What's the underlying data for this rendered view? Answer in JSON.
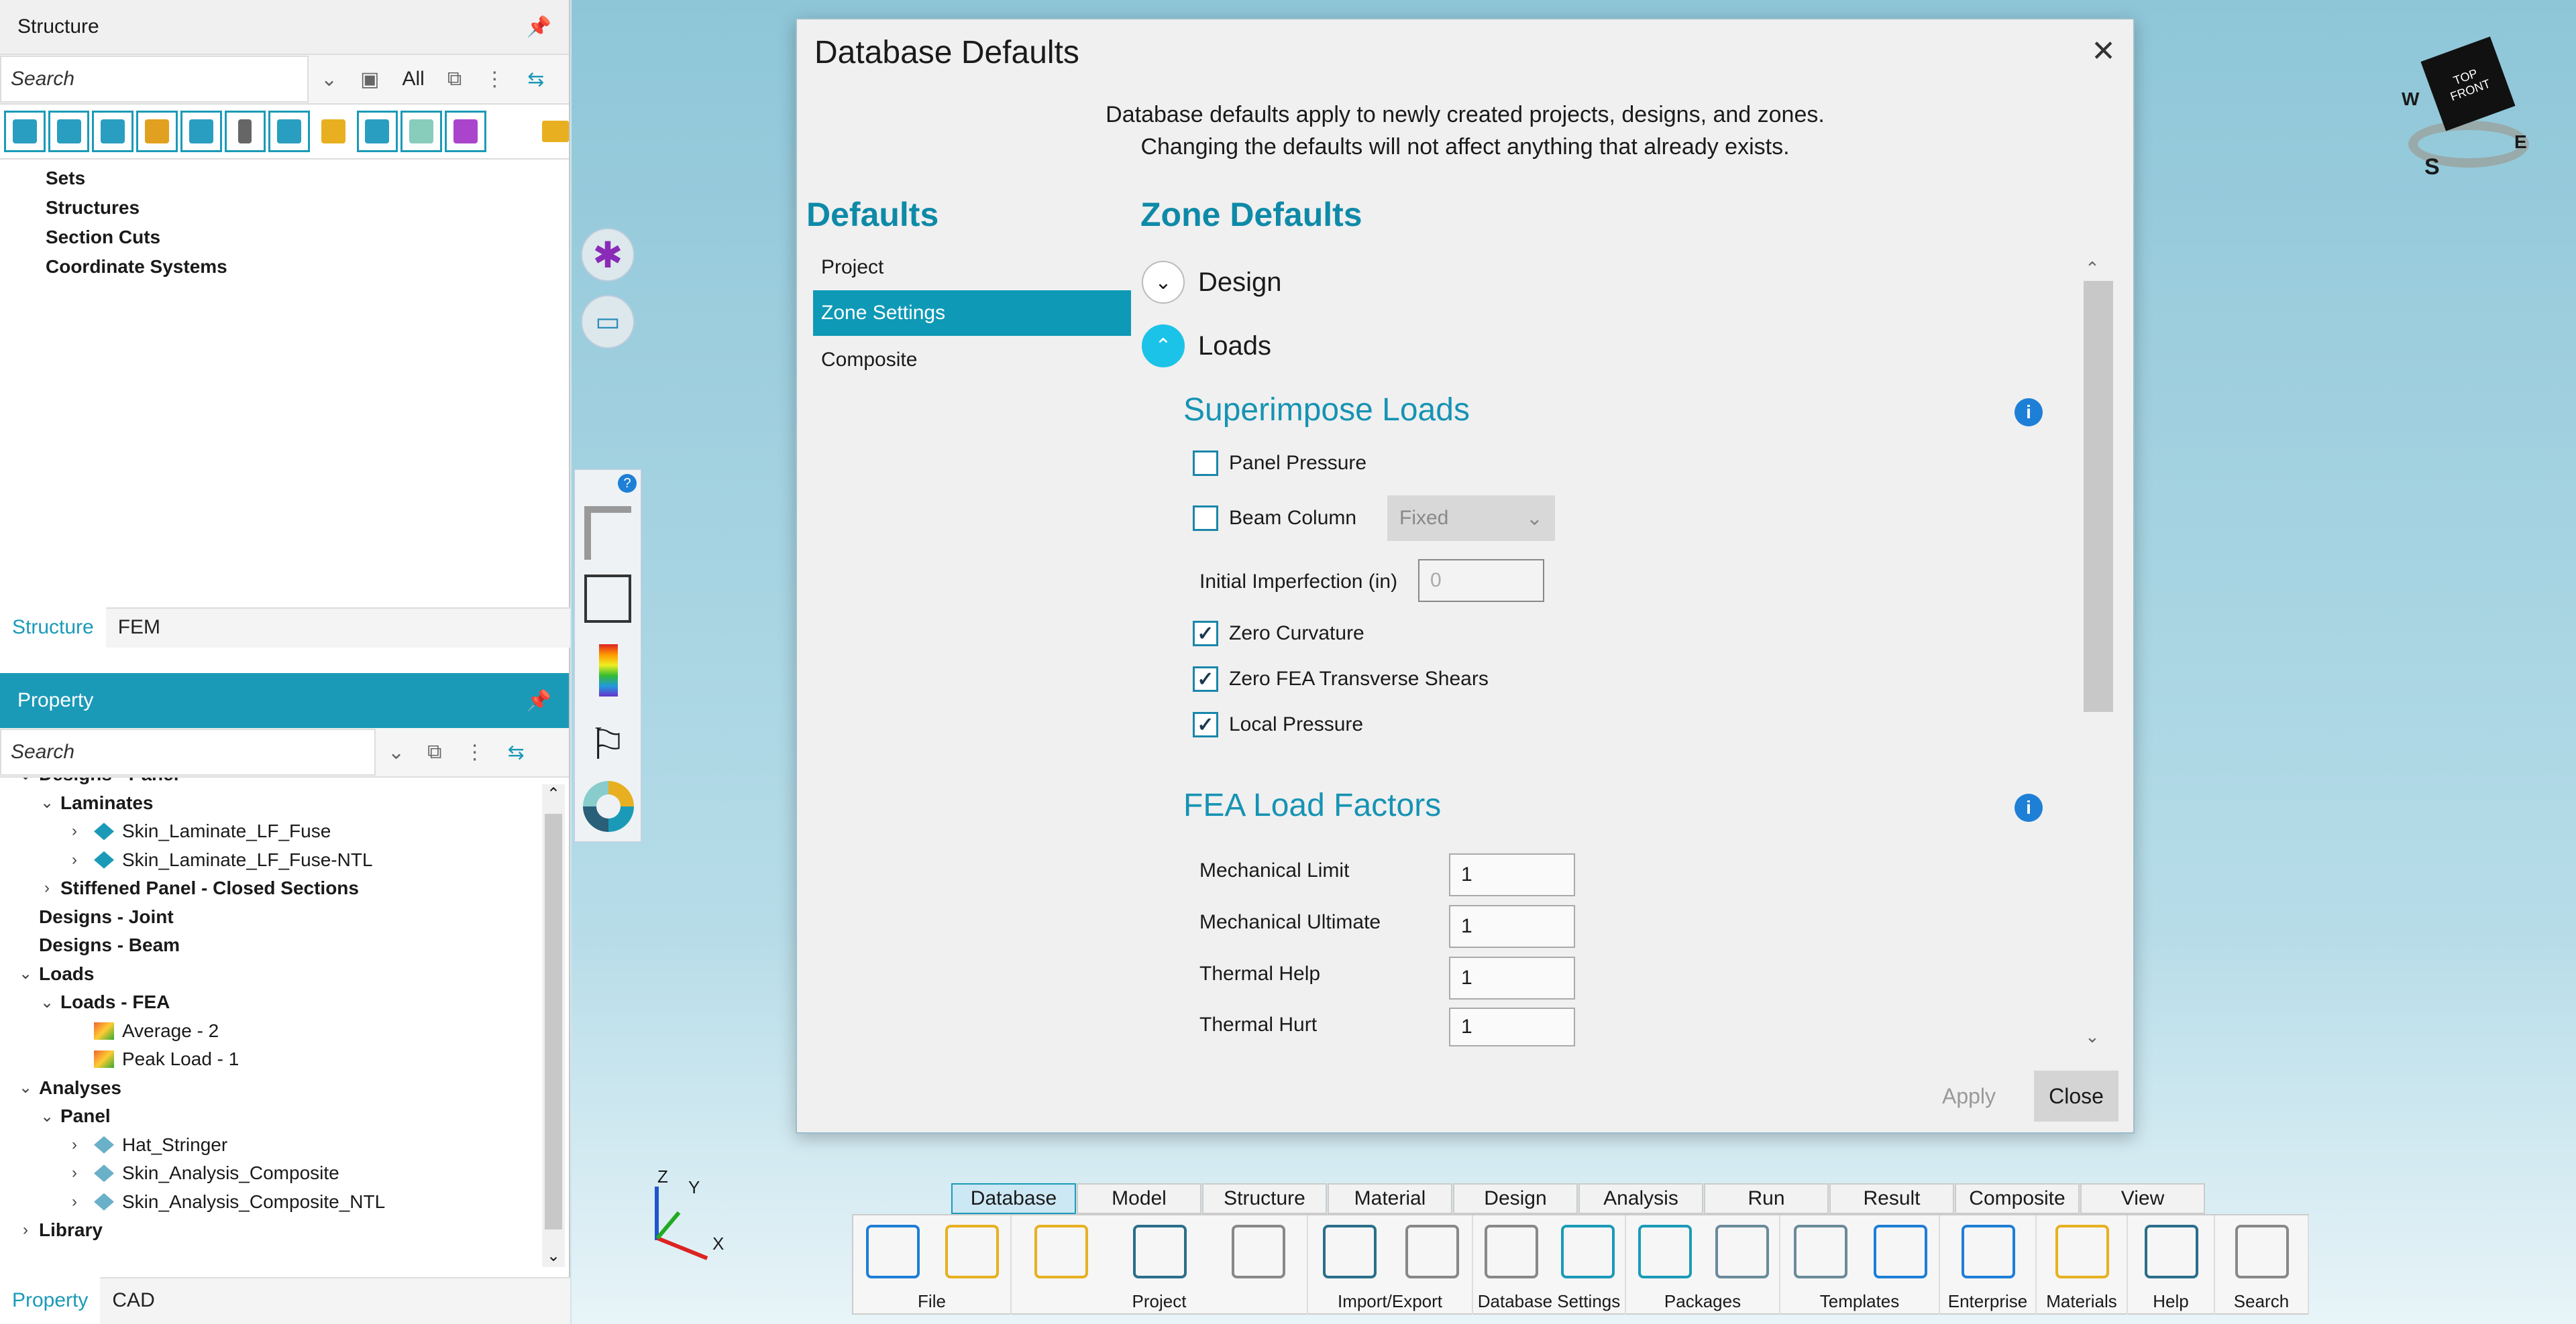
{
  "structure": {
    "title": "Structure",
    "search_placeholder": "Search",
    "filter": "All",
    "tree": [
      "Sets",
      "Structures",
      "Section Cuts",
      "Coordinate Systems"
    ],
    "tabs": [
      "Structure",
      "FEM"
    ]
  },
  "property": {
    "title": "Property",
    "search_placeholder": "Search",
    "tree": [
      {
        "label": "Designs - Panel",
        "level": 0,
        "chev": "v",
        "bold": true
      },
      {
        "label": "Laminates",
        "level": 1,
        "chev": "v",
        "bold": true
      },
      {
        "label": "Skin_Laminate_LF_Fuse",
        "level": 2,
        "chev": ">",
        "icon": "laminate-icon"
      },
      {
        "label": "Skin_Laminate_LF_Fuse-NTL",
        "level": 2,
        "chev": ">",
        "icon": "laminate-icon"
      },
      {
        "label": "Stiffened Panel - Closed Sections",
        "level": 1,
        "chev": ">",
        "bold": true
      },
      {
        "label": "Designs - Joint",
        "level": 0,
        "chev": "",
        "bold": true
      },
      {
        "label": "Designs - Beam",
        "level": 0,
        "chev": "",
        "bold": true
      },
      {
        "label": "Loads",
        "level": 0,
        "chev": "v",
        "bold": true
      },
      {
        "label": "Loads - FEA",
        "level": 1,
        "chev": "v",
        "bold": true
      },
      {
        "label": "Average - 2",
        "level": 2,
        "chev": "",
        "icon": "load-icon"
      },
      {
        "label": "Peak Load - 1",
        "level": 2,
        "chev": "",
        "icon": "load-icon"
      },
      {
        "label": "Analyses",
        "level": 0,
        "chev": "v",
        "bold": true
      },
      {
        "label": "Panel",
        "level": 1,
        "chev": "v",
        "bold": true
      },
      {
        "label": "Hat_Stringer",
        "level": 2,
        "chev": ">",
        "icon": "analysis-icon"
      },
      {
        "label": "Skin_Analysis_Composite",
        "level": 2,
        "chev": ">",
        "icon": "analysis-icon"
      },
      {
        "label": "Skin_Analysis_Composite_NTL",
        "level": 2,
        "chev": ">",
        "icon": "analysis-icon"
      },
      {
        "label": "Library",
        "level": 0,
        "chev": ">",
        "bold": true
      }
    ],
    "tabs": [
      "Property",
      "CAD"
    ]
  },
  "dialog": {
    "title": "Database Defaults",
    "close_glyph": "✕",
    "note_line1": "Database defaults apply to newly created projects, designs, and zones.",
    "note_line2": "Changing the defaults will not affect anything that already exists.",
    "nav_heading": "Defaults",
    "nav": [
      "Project",
      "Zone Settings",
      "Composite"
    ],
    "content_heading": "Zone Defaults",
    "section_design": "Design",
    "section_loads": "Loads",
    "superimpose": {
      "heading": "Superimpose Loads",
      "panel_pressure": "Panel Pressure",
      "beam_column": "Beam Column",
      "beam_column_option": "Fixed",
      "imperfection_label": "Initial Imperfection (in)",
      "imperfection_value": "0",
      "zero_curvature": "Zero Curvature",
      "zero_fea": "Zero FEA Transverse Shears",
      "local_pressure": "Local Pressure"
    },
    "fea": {
      "heading": "FEA Load Factors",
      "rows": [
        {
          "label": "Mechanical Limit",
          "value": "1"
        },
        {
          "label": "Mechanical Ultimate",
          "value": "1"
        },
        {
          "label": "Thermal Help",
          "value": "1"
        },
        {
          "label": "Thermal Hurt",
          "value": "1"
        }
      ]
    },
    "apply": "Apply",
    "close": "Close"
  },
  "cube": {
    "top": "TOP",
    "front": "FRONT",
    "w": "W",
    "s": "S",
    "e": "E"
  },
  "axes": {
    "x": "X",
    "y": "Y",
    "z": "Z"
  },
  "ribbon": {
    "tabs": [
      "Database",
      "Model",
      "Structure",
      "Material",
      "Design",
      "Analysis",
      "Run",
      "Result",
      "Composite",
      "View"
    ],
    "groups": [
      "File",
      "Project",
      "Import/Export",
      "Database Settings",
      "Packages",
      "Templates",
      "Enterprise",
      "Materials",
      "Help",
      "Search"
    ]
  }
}
